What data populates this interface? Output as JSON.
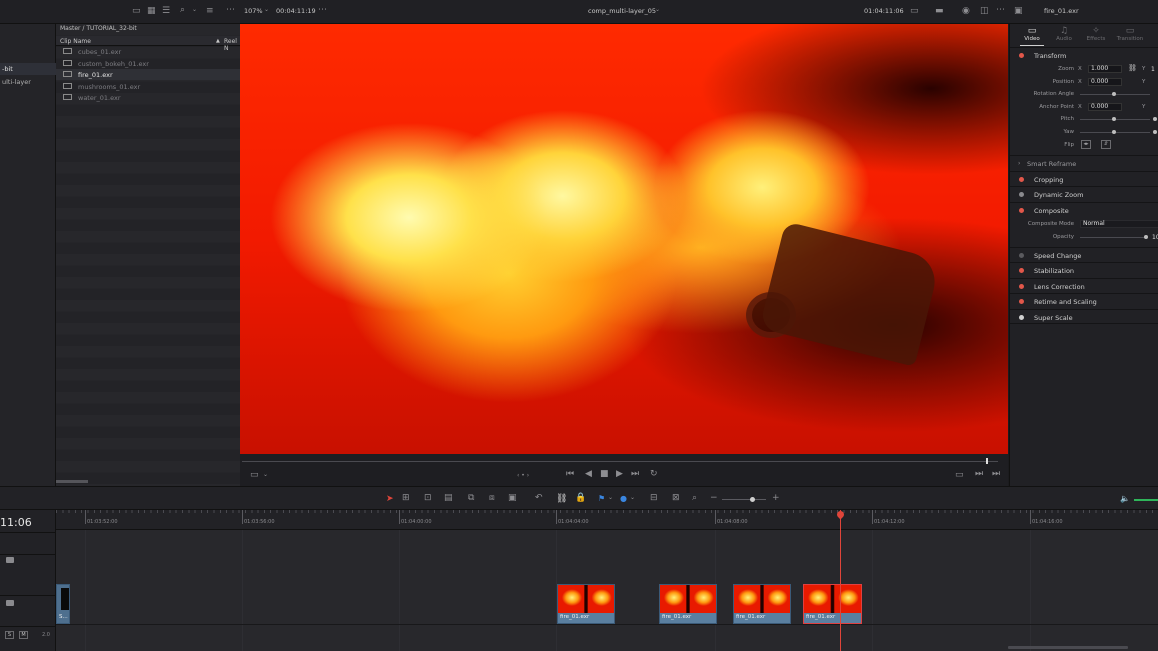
{
  "toolbar": {
    "zoom": "107%",
    "source_timecode": "00:04:11:19",
    "timeline_name": "comp_multi-layer_05",
    "record_timecode": "01:04:11:06",
    "inspector_clip": "fire_01.exr"
  },
  "bin": {
    "items": [
      {
        "label": "-bit",
        "selected": true
      },
      {
        "label": "ulti-layer",
        "selected": false
      }
    ]
  },
  "media_pool": {
    "breadcrumb": "Master / TUTORIAL_32-bit",
    "col_name": "Clip Name",
    "col_reel": "Reel N",
    "clips": [
      {
        "name": "cubes_01.exr",
        "selected": false
      },
      {
        "name": "custom_bokeh_01.exr",
        "selected": false
      },
      {
        "name": "fire_01.exr",
        "selected": true
      },
      {
        "name": "mushrooms_01.exr",
        "selected": false
      },
      {
        "name": "water_01.exr",
        "selected": false
      }
    ]
  },
  "viewer": {
    "transport_dots": "‹ • ›",
    "scrub_position": 0.985
  },
  "inspector": {
    "tabs": [
      "Video",
      "Audio",
      "Effects",
      "Transition"
    ],
    "active_tab": "Video",
    "transform_label": "Transform",
    "zoom_label": "Zoom",
    "zoom_x": "1.000",
    "zoom_y": "1",
    "position_label": "Position",
    "position_x": "0.000",
    "rotation_label": "Rotation Angle",
    "anchor_label": "Anchor Point",
    "anchor_x": "0.000",
    "pitch_label": "Pitch",
    "yaw_label": "Yaw",
    "flip_label": "Flip",
    "x": "X",
    "y": "Y",
    "smart_reframe": "Smart Reframe",
    "cropping": "Cropping",
    "dynamic_zoom": "Dynamic Zoom",
    "composite": "Composite",
    "composite_mode_label": "Composite Mode",
    "composite_mode_value": "Normal",
    "opacity_label": "Opacity",
    "opacity_value": "10",
    "speed_change": "Speed Change",
    "stabilization": "Stabilization",
    "lens_correction": "Lens Correction",
    "retime": "Retime and Scaling",
    "super_scale": "Super Scale"
  },
  "timeline": {
    "timecode": "11:06",
    "ruler": [
      "01:03:52:00",
      "01:03:56:00",
      "01:04:00:00",
      "01:04:04:00",
      "01:04:08:00",
      "01:04:12:00",
      "01:04:16:00"
    ],
    "clip_label": "fire_01.exr",
    "partial_clip_label": "S...",
    "audio_s": "S",
    "audio_m": "M",
    "audio_level": "2.0"
  }
}
